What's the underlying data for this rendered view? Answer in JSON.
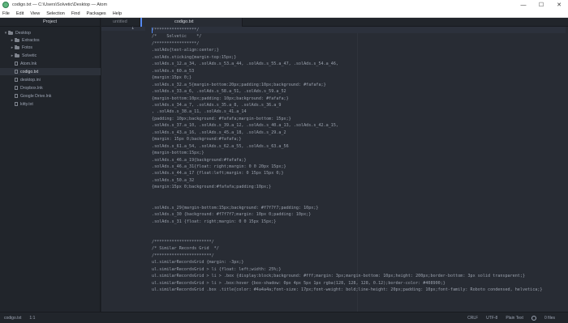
{
  "window": {
    "title": "codigo.txt — C:\\Users\\Solvetic\\Desktop — Atom",
    "minimize": "—",
    "maximize": "☐",
    "close": "✕"
  },
  "menu": [
    "File",
    "Edit",
    "View",
    "Selection",
    "Find",
    "Packages",
    "Help"
  ],
  "tree": {
    "header": "Project",
    "root": "Desktop",
    "folders": [
      "Extractos",
      "Fotos",
      "Solvetic"
    ],
    "files": [
      "Atom.lnk",
      "codigo.txt",
      "desktop.ini",
      "Dropbox.lnk",
      "Google Drive.lnk",
      "kitty.txt"
    ],
    "selected": "codigo.txt"
  },
  "tabs": [
    "untitled",
    "codigo.txt"
  ],
  "active_tab": "codigo.txt",
  "code": [
    "/*****************/",
    "/*    Solvetic    */",
    "/*****************/",
    ".solAds{text-align:center;}",
    ".solAds.sticking{margin-top:15px;}",
    ".solAds.s_12.a_34, .solAds.s_53.a_44, .solAds.s_55.a_47, .solAds.s_54.a_46,",
    ".solAds.s_60.a_53",
    "{margin:15px 0;}",
    ".solAds.s_32.a_5{margin-bottom:20px;padding:10px;background: #fafafa;}",
    ".solAds.s_33.a_6, .solAds.s_58.a_51, .solAds.s_59.a_52",
    "{margin-bottom:10px;padding: 10px;background: #fafafa;}",
    ".solAds.s_34.a_7, .solAds.s_35.a_8, .solAds.s_36.a_9",
    ", .solAds.s_38.a_11, .solAds.s_41.a_14",
    "{padding: 10px;background: #fafafa;margin-bottom: 15px;}",
    ".solAds.s_37.a_10, .solAds.s_39.a_12, .solAds.s_40.a_13, .solAds.s_42.a_15,",
    ".solAds.s_43.a_16, .solAds.s_45.a_18, .solAds.s_29.a_2",
    "{margin: 15px 0;background:#fafafa;}",
    ".solAds.s_61.a_54, .solAds.s_62.a_55, .solAds.s_63.a_56",
    "{margin-bottom:15px;}",
    ".solAds.s_46.a_19{background:#fafafa;}",
    ".solAds.s_46.a_31{float: right;margin: 0 0 20px 15px;}",
    ".solAds.s_44.a_17 {float:left;margin: 0 15px 15px 0;}",
    ".solAds.s_50.a_32",
    "{margin:15px 0;background:#fafafa;padding:10px;}",
    "",
    "",
    ".solAds.s_29{margin-bottom:15px;background: #f7f7f7;padding: 10px;}",
    ".solAds.s_30 {background: #f7f7f7;margin: 10px 0;padding: 10px;}",
    ".solAds.s_31 {float: right;margin: 0 0 15px 15px;}",
    "",
    "",
    "/***********************/",
    "/* Similar Records Grid  */",
    "/***********************/",
    "ul.similarRecordsGrid {margin: -3px;}",
    "ul.similarRecordsGrid > li {float: left;width: 25%;}",
    "ul.similarRecordsGrid > li > .box {display:block;background: #fff;margin: 3px;margin-bottom: 10px;height: 200px;border-bottom: 3px solid transparent;}",
    "ul.similarRecordsGrid > li > .box:hover {box-shadow: 0px 4px 5px 1px rgba(128, 128, 128, 0.12);border-color: #408900;}",
    "ul.similarRecordsGrid .box .title{color: #4a4a4a;font-size: 17px;font-weight: bold;line-height: 20px;padding: 10px;font-family: Roboto condensed, helvetica;}"
  ],
  "status": {
    "file": "codigo.txt",
    "position": "1:1",
    "line_ending": "CRLF",
    "encoding": "UTF-8",
    "grammar": "Plain Text",
    "files": "0 files"
  }
}
